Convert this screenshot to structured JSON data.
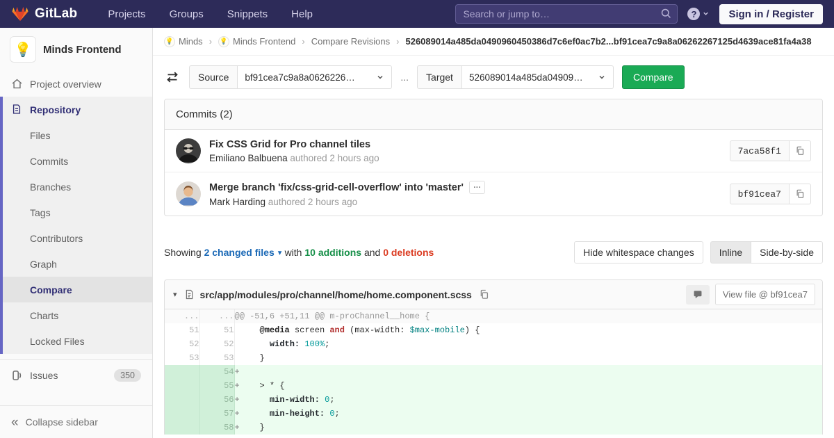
{
  "navbar": {
    "logo_text": "GitLab",
    "links": [
      "Projects",
      "Groups",
      "Snippets",
      "Help"
    ],
    "search_placeholder": "Search or jump to…",
    "help_glyph": "?",
    "signin_label": "Sign in / Register"
  },
  "sidebar": {
    "project_name": "Minds Frontend",
    "project_avatar_emoji": "💡",
    "overview_label": "Project overview",
    "repository_label": "Repository",
    "repo_items": [
      "Files",
      "Commits",
      "Branches",
      "Tags",
      "Contributors",
      "Graph",
      "Compare",
      "Charts",
      "Locked Files"
    ],
    "active_item": "Compare",
    "issues_label": "Issues",
    "issues_count": "350",
    "collapse_glyph": "«",
    "collapse_label": "Collapse sidebar"
  },
  "breadcrumb": {
    "group": "Minds",
    "project": "Minds Frontend",
    "section": "Compare Revisions",
    "separator": "›",
    "avatar_emoji": "💡",
    "current": "526089014a485da0490960450386d7c6ef0ac7b2...bf91cea7c9a8a06262267125d4639ace81fa4a38"
  },
  "compare_form": {
    "source_label": "Source",
    "source_value": "bf91cea7c9a8a0626226…",
    "separator": "...",
    "target_label": "Target",
    "target_value": "526089014a485da04909…",
    "compare_button": "Compare"
  },
  "commits": {
    "header": "Commits (2)",
    "expander_glyph": "…",
    "items": [
      {
        "title": "Fix CSS Grid for Pro channel tiles",
        "author": "Emiliano Balbuena",
        "meta": "authored 2 hours ago",
        "sha": "7aca58f1"
      },
      {
        "title": "Merge branch 'fix/css-grid-cell-overflow' into 'master'",
        "author": "Mark Harding",
        "meta": "authored 2 hours ago",
        "sha": "bf91cea7"
      }
    ]
  },
  "diff_summary": {
    "showing": "Showing",
    "changed_files": "2 changed files",
    "caret": "▾",
    "with_text": "with",
    "additions": "10 additions",
    "and_text": "and",
    "deletions": "0 deletions",
    "hide_whitespace": "Hide whitespace changes",
    "inline": "Inline",
    "side_by_side": "Side-by-side"
  },
  "diff_file": {
    "collapse_glyph": "▾",
    "path": "src/app/modules/pro/channel/home/home.component.scss",
    "view_file": "View file @ bf91cea7",
    "lines": [
      {
        "old": "...",
        "new": "...",
        "type": "hunk",
        "tokens": [
          {
            "t": "@@ -51,6 +51,11 @@ m-proChannel__home {",
            "c": ""
          }
        ]
      },
      {
        "old": "51",
        "new": "51",
        "type": "ctx",
        "tokens": [
          {
            "t": "     ",
            "c": ""
          },
          {
            "t": "@media",
            "c": "k"
          },
          {
            "t": " screen ",
            "c": ""
          },
          {
            "t": "and",
            "c": "ow"
          },
          {
            "t": " (max-width: ",
            "c": ""
          },
          {
            "t": "$max-mobile",
            "c": "nv"
          },
          {
            "t": ") {",
            "c": ""
          }
        ]
      },
      {
        "old": "52",
        "new": "52",
        "type": "ctx",
        "tokens": [
          {
            "t": "       ",
            "c": ""
          },
          {
            "t": "width:",
            "c": "nl"
          },
          {
            "t": " ",
            "c": ""
          },
          {
            "t": "100%",
            "c": "m"
          },
          {
            "t": ";",
            "c": ""
          }
        ]
      },
      {
        "old": "53",
        "new": "53",
        "type": "ctx",
        "tokens": [
          {
            "t": "     }",
            "c": ""
          }
        ]
      },
      {
        "old": "",
        "new": "54",
        "type": "add",
        "tokens": [
          {
            "t": "+",
            "c": "pre"
          }
        ]
      },
      {
        "old": "",
        "new": "55",
        "type": "add",
        "tokens": [
          {
            "t": "+",
            "c": "pre"
          },
          {
            "t": "    > * {",
            "c": ""
          }
        ]
      },
      {
        "old": "",
        "new": "56",
        "type": "add",
        "tokens": [
          {
            "t": "+",
            "c": "pre"
          },
          {
            "t": "      ",
            "c": ""
          },
          {
            "t": "min-width:",
            "c": "nl"
          },
          {
            "t": " ",
            "c": ""
          },
          {
            "t": "0",
            "c": "m"
          },
          {
            "t": ";",
            "c": ""
          }
        ]
      },
      {
        "old": "",
        "new": "57",
        "type": "add",
        "tokens": [
          {
            "t": "+",
            "c": "pre"
          },
          {
            "t": "      ",
            "c": ""
          },
          {
            "t": "min-height:",
            "c": "nl"
          },
          {
            "t": " ",
            "c": ""
          },
          {
            "t": "0",
            "c": "m"
          },
          {
            "t": ";",
            "c": ""
          }
        ]
      },
      {
        "old": "",
        "new": "58",
        "type": "add",
        "tokens": [
          {
            "t": "+",
            "c": "pre"
          },
          {
            "t": "    }",
            "c": ""
          }
        ]
      }
    ]
  },
  "colors": {
    "navbar_bg": "#2d2b59",
    "brand_orange": "#fc6d26",
    "brand_red": "#e24329",
    "brand_yellow": "#fca326",
    "green_button": "#1aaa55",
    "additions_green": "#168f48",
    "deletions_red": "#db3b21",
    "link_blue": "#1b69b6",
    "sidebar_active_indigo": "#312f75",
    "added_line_bg": "#ecfdf0",
    "added_gutter_bg": "#d0f0d9"
  }
}
